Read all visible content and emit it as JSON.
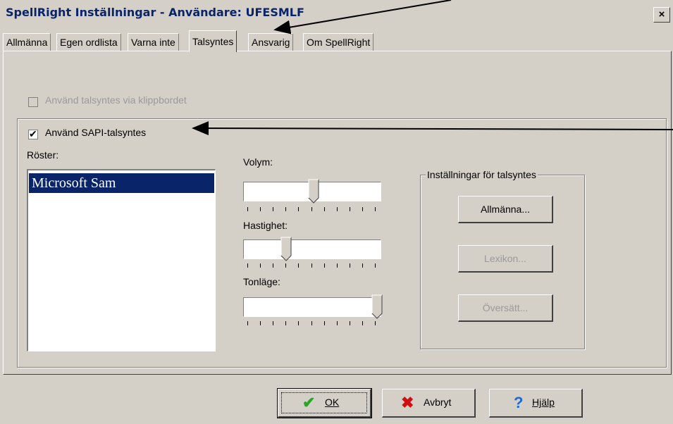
{
  "window": {
    "title": "SpellRight  Inställningar - Användare: UFESMLF",
    "close_label": "×"
  },
  "tabs": [
    {
      "label": "Allmänna",
      "underline": "A"
    },
    {
      "label": "Egen ordlista",
      "underline": "E"
    },
    {
      "label": "Varna inte",
      "underline": "V"
    },
    {
      "label": "Talsyntes",
      "underline": "T",
      "active": true
    },
    {
      "label": "Ansvarig",
      "underline": "g"
    },
    {
      "label": "Om SpellRight",
      "underline": "R"
    }
  ],
  "clipboard_option": {
    "label": "Använd talsyntes via klippbordet",
    "checked": false,
    "enabled": false
  },
  "sapi": {
    "label": "Använd SAPI-talsyntes",
    "checked": true,
    "voices_label": "Röster:",
    "voices": [
      "Microsoft Sam"
    ],
    "selected_voice": "Microsoft Sam",
    "volume_label": "Volym:",
    "volume_level": 0.5,
    "speed_label": "Hastighet:",
    "speed_level": 0.3,
    "pitch_label": "Tonläge:",
    "pitch_level": 1.0
  },
  "settings_group": {
    "title": "Inställningar för talsyntes",
    "general_button": "Allmänna...",
    "lexicon_button": "Lexikon...",
    "translate_button": "Översätt..."
  },
  "footer": {
    "ok": "OK",
    "cancel": "Avbryt",
    "help": "Hjälp"
  },
  "colors": {
    "face": "#d4d0c8",
    "selection": "#0a246a",
    "ok_icon": "#2aa52a",
    "cancel_icon": "#d01010",
    "help_icon": "#1a6ad8"
  }
}
